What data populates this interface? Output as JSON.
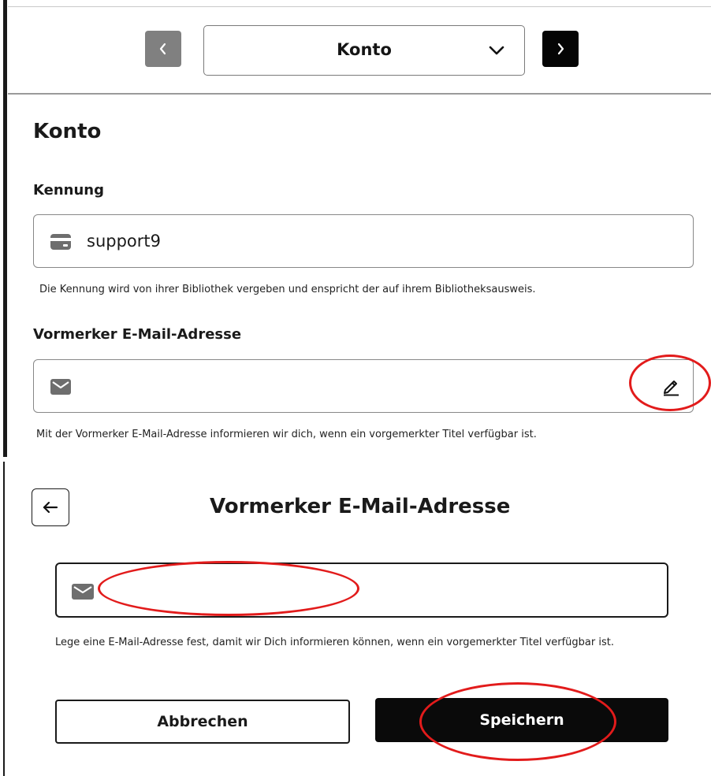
{
  "top": {
    "selector": {
      "value": "Konto"
    },
    "page_title": "Konto",
    "kennung": {
      "label": "Kennung",
      "value": "support9",
      "hint": "Die Kennung wird von ihrer Bibliothek vergeben und enspricht der auf ihrem Bibliotheksausweis."
    },
    "email": {
      "label": "Vormerker E-Mail-Adresse",
      "value": "",
      "hint": "Mit der Vormerker E-Mail-Adresse informieren wir dich, wenn ein vorgemerkter Titel verfügbar ist."
    }
  },
  "dialog": {
    "title": "Vormerker E-Mail-Adresse",
    "email_value": "",
    "hint": "Lege eine E-Mail-Adresse fest, damit wir Dich informieren können, wenn ein vorgemerkter Titel verfügbar ist.",
    "cancel_label": "Abbrechen",
    "save_label": "Speichern"
  },
  "icons": {
    "prev": "chevron-left-icon",
    "next": "chevron-right-icon",
    "dropdown": "chevron-down-icon",
    "card": "id-card-icon",
    "mail": "mail-icon",
    "edit": "pencil-icon",
    "back": "arrow-left-icon"
  },
  "colors": {
    "annotation": "#e21b1b",
    "primary_button": "#0a0a0a",
    "prev_button": "#808080"
  }
}
